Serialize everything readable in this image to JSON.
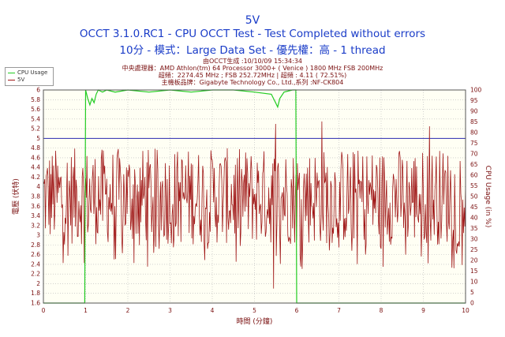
{
  "chart_data": {
    "type": "line",
    "title": "5V",
    "subtitle": "OCCT 3.1.0.RC1 - CPU OCCT Test - Test Completed without errors",
    "subtitle2": "10分 - 模式：Large Data Set - 優先權：高 - 1 thread",
    "info": [
      "由OCCT生成 :10/10/09 15:34:34",
      "中央處理器：AMD Athlon(tm) 64 Processor 3000+ ( Venice ) 1800 MHz FSB 200MHz",
      "超頻：2274.45 MHz ; FSB 252.72MHz | 超頻 : 4.11 ( 72.51%)",
      "主機板品牌：Gigabyte Technology Co., Ltd.,系列 :NF-CK804"
    ],
    "xlabel": "時間 (分鐘)",
    "ylabel": "電壓 (伏特)",
    "y2label": "CPU Usage (in %)",
    "xlim": [
      0,
      10
    ],
    "ylim": [
      1.6,
      6
    ],
    "y2lim": [
      0,
      100
    ],
    "xticks": [
      "0",
      "1",
      "2",
      "3",
      "4",
      "5",
      "6",
      "7",
      "8",
      "9",
      "10"
    ],
    "yticks": [
      "1.6",
      "1.8",
      "2",
      "2.2",
      "2.4",
      "2.6",
      "2.8",
      "3",
      "3.2",
      "3.4",
      "3.6",
      "3.8",
      "4",
      "4.2",
      "4.4",
      "4.6",
      "4.8",
      "5",
      "5.2",
      "5.4",
      "5.6",
      "5.8",
      "6"
    ],
    "y2ticks": [
      "0",
      "5",
      "10",
      "15",
      "20",
      "25",
      "30",
      "35",
      "40",
      "45",
      "50",
      "55",
      "60",
      "65",
      "70",
      "75",
      "80",
      "85",
      "90",
      "95",
      "100"
    ],
    "reference_line": 5,
    "grid": true,
    "legend_position": "top-left",
    "colors": {
      "voltage": "#a01818",
      "cpu": "#22cc22",
      "reference": "#2a2ab0",
      "text": "#7a1010",
      "title": "#1a3cc8",
      "grid": "#b8b8b8"
    },
    "series": [
      {
        "name": "5V",
        "axis": "left",
        "x_range": [
          0,
          10
        ],
        "summary": {
          "min": 1.9,
          "max": 5.35,
          "typical_low": 2.8,
          "typical_high": 4.8
        }
      },
      {
        "name": "CPU Usage",
        "axis": "right",
        "x": [
          0,
          0.98,
          1.0,
          1.05,
          1.1,
          1.15,
          1.2,
          1.25,
          1.3,
          1.4,
          1.5,
          1.7,
          2.0,
          2.5,
          3.0,
          3.5,
          4.0,
          4.5,
          5.0,
          5.4,
          5.5,
          5.55,
          5.6,
          5.7,
          5.9,
          5.98,
          6.0,
          10
        ],
        "values": [
          0,
          0,
          100,
          96,
          93,
          96,
          94,
          98,
          100,
          99,
          100,
          99,
          100,
          99,
          100,
          99,
          100,
          100,
          99,
          98,
          94,
          92,
          96,
          99,
          100,
          100,
          0,
          0
        ]
      }
    ]
  }
}
